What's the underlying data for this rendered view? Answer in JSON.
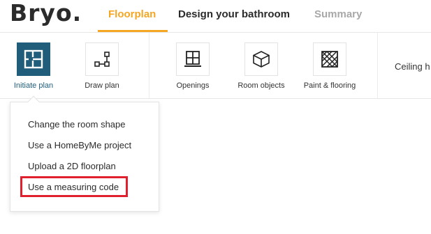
{
  "header": {
    "logo": "Bryo.",
    "tabs": [
      {
        "label": "Floorplan",
        "state": "active"
      },
      {
        "label": "Design your bathroom",
        "state": "default"
      },
      {
        "label": "Summary",
        "state": "disabled"
      }
    ]
  },
  "toolbar": {
    "tools": [
      {
        "label": "Initiate plan",
        "icon": "floorplan-grid-icon",
        "selected": true
      },
      {
        "label": "Draw plan",
        "icon": "draw-plan-icon",
        "selected": false
      },
      {
        "label": "Openings",
        "icon": "window-icon",
        "selected": false
      },
      {
        "label": "Room objects",
        "icon": "cube-icon",
        "selected": false
      },
      {
        "label": "Paint & flooring",
        "icon": "tile-pattern-icon",
        "selected": false
      }
    ],
    "ceiling_label": "Ceiling h"
  },
  "dropdown": {
    "items": [
      {
        "label": "Change the room shape"
      },
      {
        "label": "Use a HomeByMe project"
      },
      {
        "label": "Upload a 2D floorplan"
      },
      {
        "label": "Use a measuring code",
        "highlighted": true
      }
    ]
  },
  "colors": {
    "accent": "#f5a623",
    "selected": "#1f5d7a",
    "highlight": "#e0202e",
    "muted": "#a8a8a8"
  }
}
